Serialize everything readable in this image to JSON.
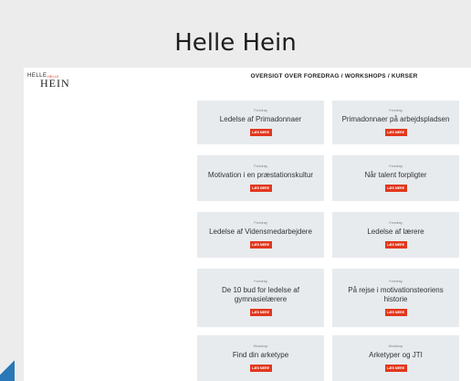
{
  "slide": {
    "title": "Helle Hein"
  },
  "site": {
    "logo": {
      "top": "HELLE",
      "mark": "HELLE",
      "bottom": "HEIN"
    },
    "heading": "OVERSIGT OVER FOREDRAG / WORKSHOPS / KURSER"
  },
  "cards": [
    {
      "category": "Foredrag",
      "title": "Ledelse af Primadonnaer",
      "button": "LÆS MERE"
    },
    {
      "category": "Foredrag",
      "title": "Primadonnaer på arbejdspladsen",
      "button": "LÆS MERE"
    },
    {
      "category": "Foredrag",
      "title": "Motivation i en præstationskultur",
      "button": "LÆS MERE"
    },
    {
      "category": "Foredrag",
      "title": "Når talent forpligter",
      "button": "LÆS MERE"
    },
    {
      "category": "Foredrag",
      "title": "Ledelse af Vidensmedarbejdere",
      "button": "LÆS MERE"
    },
    {
      "category": "Foredrag",
      "title": "Ledelse af lærere",
      "button": "LÆS MERE"
    },
    {
      "category": "Foredrag",
      "title": "De 10 bud for ledelse af gymnasielærere",
      "button": "LÆS MERE"
    },
    {
      "category": "Foredrag",
      "title": "På rejse i motivationsteoriens historie",
      "button": "LÆS MERE"
    },
    {
      "category": "Workshop",
      "title": "Find din arketype",
      "button": "LÆS MERE"
    },
    {
      "category": "Workshop",
      "title": "Arketyper og JTI",
      "button": "LÆS MERE"
    }
  ]
}
